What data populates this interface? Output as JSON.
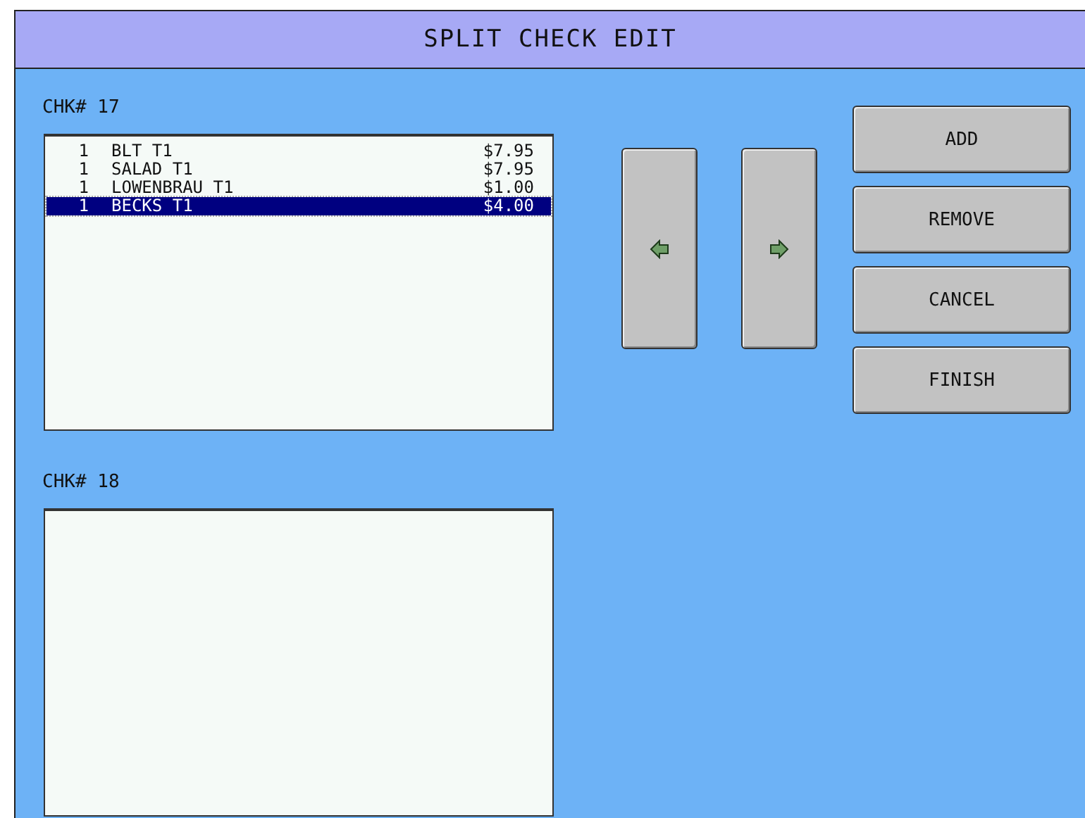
{
  "window": {
    "title": "SPLIT CHECK EDIT"
  },
  "checks": [
    {
      "label": "CHK# 17",
      "items": [
        {
          "qty": "1",
          "name": "BLT T1",
          "price": "$7.95",
          "selected": false
        },
        {
          "qty": "1",
          "name": "SALAD T1",
          "price": "$7.95",
          "selected": false
        },
        {
          "qty": "1",
          "name": "LOWENBRAU T1",
          "price": "$1.00",
          "selected": false
        },
        {
          "qty": "1",
          "name": "BECKS T1",
          "price": "$4.00",
          "selected": true
        }
      ]
    },
    {
      "label": "CHK# 18"
    }
  ],
  "move_buttons": [
    {
      "kind": "left"
    },
    {
      "kind": "right"
    }
  ],
  "buttons": [
    "ADD",
    "REMOVE",
    "CANCEL",
    "FINISH"
  ]
}
